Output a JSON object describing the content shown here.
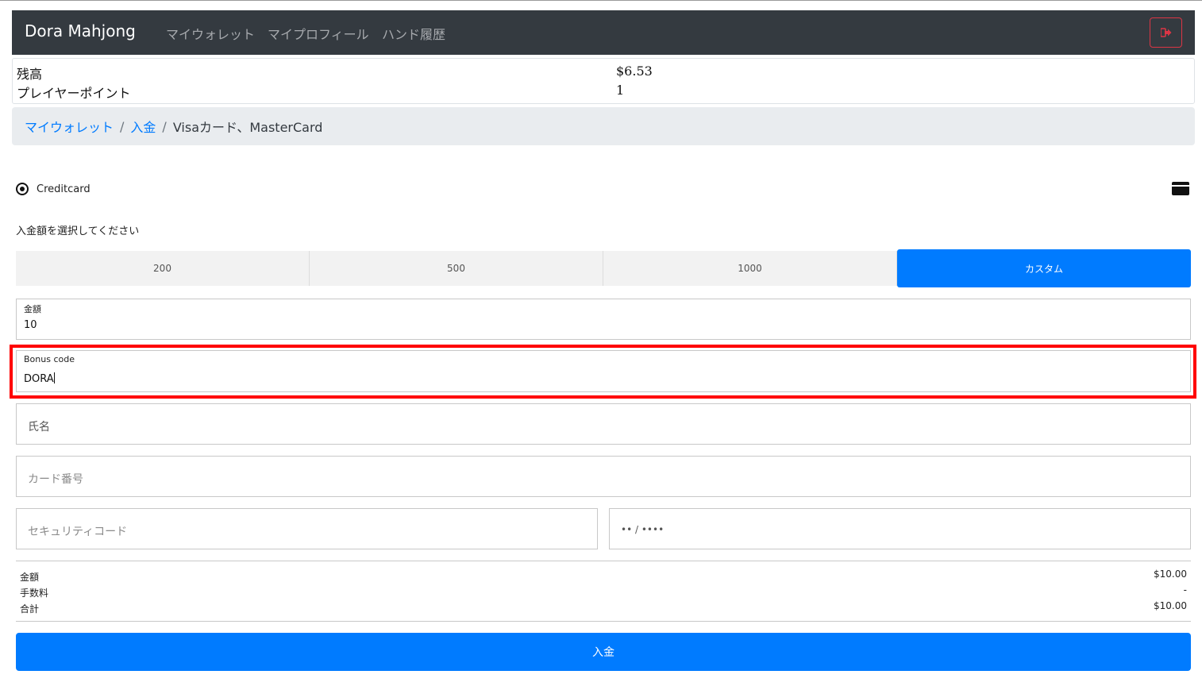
{
  "navbar": {
    "brand": "Dora Mahjong",
    "links": [
      "マイウォレット",
      "マイプロフィール",
      "ハンド履歴"
    ],
    "logout_icon": "sign-out-icon"
  },
  "balance": {
    "rows": [
      {
        "label": "残高",
        "value": "$6.53"
      },
      {
        "label": "プレイヤーポイント",
        "value": "1"
      }
    ]
  },
  "breadcrumb": {
    "items": [
      "マイウォレット",
      "入金"
    ],
    "current": "Visaカード、MasterCard",
    "separator": "/"
  },
  "payment_method": {
    "label": "Creditcard",
    "selected": true,
    "icon": "credit-card-icon"
  },
  "amount_select": {
    "label": "入金額を選択してください",
    "options": [
      "200",
      "500",
      "1000",
      "カスタム"
    ],
    "selected": "カスタム"
  },
  "form": {
    "amount": {
      "label": "金額",
      "value": "10"
    },
    "bonus_code": {
      "label": "Bonus code",
      "value": "DORA"
    },
    "name": {
      "placeholder": "氏名"
    },
    "card_number": {
      "placeholder": "カード番号"
    },
    "security_code": {
      "placeholder": "セキュリティコード"
    },
    "expiry": {
      "placeholder": "•• / ••••"
    }
  },
  "summary": {
    "rows": [
      {
        "label": "金額",
        "value": "$10.00"
      },
      {
        "label": "手数料",
        "value": "-"
      },
      {
        "label": "合計",
        "value": "$10.00"
      }
    ]
  },
  "submit": {
    "label": "入金"
  },
  "colors": {
    "navbar_bg": "#343a40",
    "primary": "#007bff",
    "highlight": "#ff0000",
    "logout": "#dc3545"
  }
}
